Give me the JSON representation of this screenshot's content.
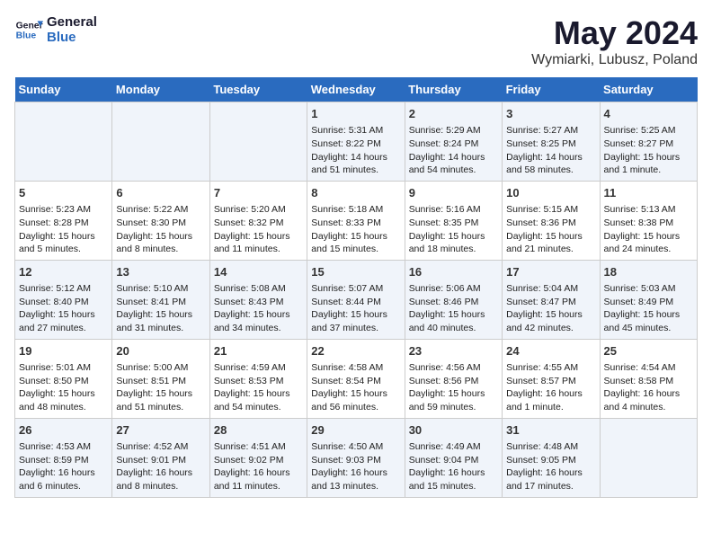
{
  "header": {
    "logo_line1": "General",
    "logo_line2": "Blue",
    "title": "May 2024",
    "subtitle": "Wymiarki, Lubusz, Poland"
  },
  "days_of_week": [
    "Sunday",
    "Monday",
    "Tuesday",
    "Wednesday",
    "Thursday",
    "Friday",
    "Saturday"
  ],
  "weeks": [
    [
      {
        "day": "",
        "content": ""
      },
      {
        "day": "",
        "content": ""
      },
      {
        "day": "",
        "content": ""
      },
      {
        "day": "1",
        "content": "Sunrise: 5:31 AM\nSunset: 8:22 PM\nDaylight: 14 hours\nand 51 minutes."
      },
      {
        "day": "2",
        "content": "Sunrise: 5:29 AM\nSunset: 8:24 PM\nDaylight: 14 hours\nand 54 minutes."
      },
      {
        "day": "3",
        "content": "Sunrise: 5:27 AM\nSunset: 8:25 PM\nDaylight: 14 hours\nand 58 minutes."
      },
      {
        "day": "4",
        "content": "Sunrise: 5:25 AM\nSunset: 8:27 PM\nDaylight: 15 hours\nand 1 minute."
      }
    ],
    [
      {
        "day": "5",
        "content": "Sunrise: 5:23 AM\nSunset: 8:28 PM\nDaylight: 15 hours\nand 5 minutes."
      },
      {
        "day": "6",
        "content": "Sunrise: 5:22 AM\nSunset: 8:30 PM\nDaylight: 15 hours\nand 8 minutes."
      },
      {
        "day": "7",
        "content": "Sunrise: 5:20 AM\nSunset: 8:32 PM\nDaylight: 15 hours\nand 11 minutes."
      },
      {
        "day": "8",
        "content": "Sunrise: 5:18 AM\nSunset: 8:33 PM\nDaylight: 15 hours\nand 15 minutes."
      },
      {
        "day": "9",
        "content": "Sunrise: 5:16 AM\nSunset: 8:35 PM\nDaylight: 15 hours\nand 18 minutes."
      },
      {
        "day": "10",
        "content": "Sunrise: 5:15 AM\nSunset: 8:36 PM\nDaylight: 15 hours\nand 21 minutes."
      },
      {
        "day": "11",
        "content": "Sunrise: 5:13 AM\nSunset: 8:38 PM\nDaylight: 15 hours\nand 24 minutes."
      }
    ],
    [
      {
        "day": "12",
        "content": "Sunrise: 5:12 AM\nSunset: 8:40 PM\nDaylight: 15 hours\nand 27 minutes."
      },
      {
        "day": "13",
        "content": "Sunrise: 5:10 AM\nSunset: 8:41 PM\nDaylight: 15 hours\nand 31 minutes."
      },
      {
        "day": "14",
        "content": "Sunrise: 5:08 AM\nSunset: 8:43 PM\nDaylight: 15 hours\nand 34 minutes."
      },
      {
        "day": "15",
        "content": "Sunrise: 5:07 AM\nSunset: 8:44 PM\nDaylight: 15 hours\nand 37 minutes."
      },
      {
        "day": "16",
        "content": "Sunrise: 5:06 AM\nSunset: 8:46 PM\nDaylight: 15 hours\nand 40 minutes."
      },
      {
        "day": "17",
        "content": "Sunrise: 5:04 AM\nSunset: 8:47 PM\nDaylight: 15 hours\nand 42 minutes."
      },
      {
        "day": "18",
        "content": "Sunrise: 5:03 AM\nSunset: 8:49 PM\nDaylight: 15 hours\nand 45 minutes."
      }
    ],
    [
      {
        "day": "19",
        "content": "Sunrise: 5:01 AM\nSunset: 8:50 PM\nDaylight: 15 hours\nand 48 minutes."
      },
      {
        "day": "20",
        "content": "Sunrise: 5:00 AM\nSunset: 8:51 PM\nDaylight: 15 hours\nand 51 minutes."
      },
      {
        "day": "21",
        "content": "Sunrise: 4:59 AM\nSunset: 8:53 PM\nDaylight: 15 hours\nand 54 minutes."
      },
      {
        "day": "22",
        "content": "Sunrise: 4:58 AM\nSunset: 8:54 PM\nDaylight: 15 hours\nand 56 minutes."
      },
      {
        "day": "23",
        "content": "Sunrise: 4:56 AM\nSunset: 8:56 PM\nDaylight: 15 hours\nand 59 minutes."
      },
      {
        "day": "24",
        "content": "Sunrise: 4:55 AM\nSunset: 8:57 PM\nDaylight: 16 hours\nand 1 minute."
      },
      {
        "day": "25",
        "content": "Sunrise: 4:54 AM\nSunset: 8:58 PM\nDaylight: 16 hours\nand 4 minutes."
      }
    ],
    [
      {
        "day": "26",
        "content": "Sunrise: 4:53 AM\nSunset: 8:59 PM\nDaylight: 16 hours\nand 6 minutes."
      },
      {
        "day": "27",
        "content": "Sunrise: 4:52 AM\nSunset: 9:01 PM\nDaylight: 16 hours\nand 8 minutes."
      },
      {
        "day": "28",
        "content": "Sunrise: 4:51 AM\nSunset: 9:02 PM\nDaylight: 16 hours\nand 11 minutes."
      },
      {
        "day": "29",
        "content": "Sunrise: 4:50 AM\nSunset: 9:03 PM\nDaylight: 16 hours\nand 13 minutes."
      },
      {
        "day": "30",
        "content": "Sunrise: 4:49 AM\nSunset: 9:04 PM\nDaylight: 16 hours\nand 15 minutes."
      },
      {
        "day": "31",
        "content": "Sunrise: 4:48 AM\nSunset: 9:05 PM\nDaylight: 16 hours\nand 17 minutes."
      },
      {
        "day": "",
        "content": ""
      }
    ]
  ]
}
